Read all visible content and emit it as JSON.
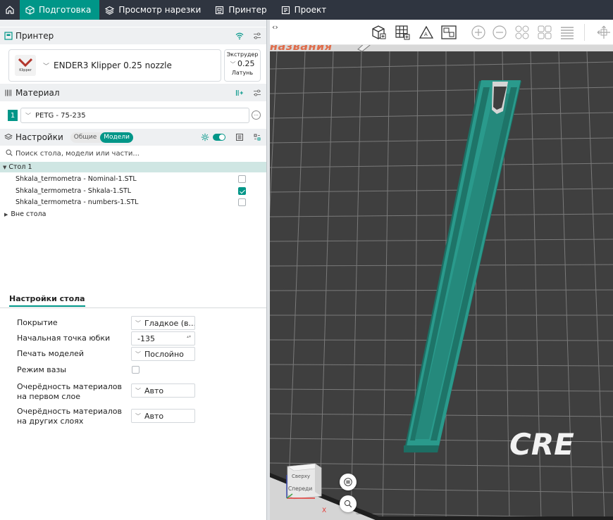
{
  "topbar": {
    "tabs": [
      {
        "label": "Подготовка",
        "icon": "cube-icon",
        "active": true
      },
      {
        "label": "Просмотр нарезки",
        "icon": "layers-icon",
        "active": false
      },
      {
        "label": "Принтер",
        "icon": "printer-monitor-icon",
        "active": false
      },
      {
        "label": "Проект",
        "icon": "project-icon",
        "active": false
      }
    ]
  },
  "printer_section": {
    "title": "Принтер",
    "printer_name": "ENDER3 Klipper 0.25 nozzle",
    "logo_text": "Klipper",
    "extruder": {
      "label": "Экструдер",
      "value": "0.25",
      "material": "Латунь"
    }
  },
  "material_section": {
    "title": "Материал",
    "index": "1",
    "material": "PETG - 75-235",
    "more": "···"
  },
  "settings_section": {
    "title": "Настройки",
    "segment": {
      "left": "Общие",
      "right": "Модели",
      "active": "right"
    }
  },
  "search": {
    "placeholder": "Поиск стола, модели или части..."
  },
  "object_tree": {
    "plate_label": "Стол 1",
    "items": [
      {
        "name": "Shkala_termometra - Nominal-1.STL",
        "checked": false
      },
      {
        "name": "Shkala_termometra - Shkala-1.STL",
        "checked": true
      },
      {
        "name": "Shkala_termometra - numbers-1.STL",
        "checked": false
      }
    ],
    "outside_label": "Вне стола"
  },
  "plate_settings": {
    "tab_label": "Настройки стола",
    "rows": [
      {
        "label": "Покрытие",
        "value": "Гладкое (в..."
      },
      {
        "label": "Начальная точка юбки",
        "value": "-135"
      },
      {
        "label": "Печать моделей",
        "value": "Послойно"
      },
      {
        "label": "Режим вазы"
      },
      {
        "label_line1": "Очерёдность материалов",
        "label_line2": "на первом слое",
        "value": "Авто"
      },
      {
        "label_line1": "Очерёдность материалов",
        "label_line2": "на других слоях",
        "value": "Авто"
      }
    ]
  },
  "viewport": {
    "plate_text": "названия",
    "bed_logo": "CRE",
    "view_cube": {
      "top": "Сверху",
      "front": "Спереди",
      "axis": "X"
    },
    "accent_color": "#2a9a8c",
    "bed_color": "#3f3f3f"
  },
  "colors": {
    "accent": "#009688",
    "topbar": "#2f3540"
  }
}
